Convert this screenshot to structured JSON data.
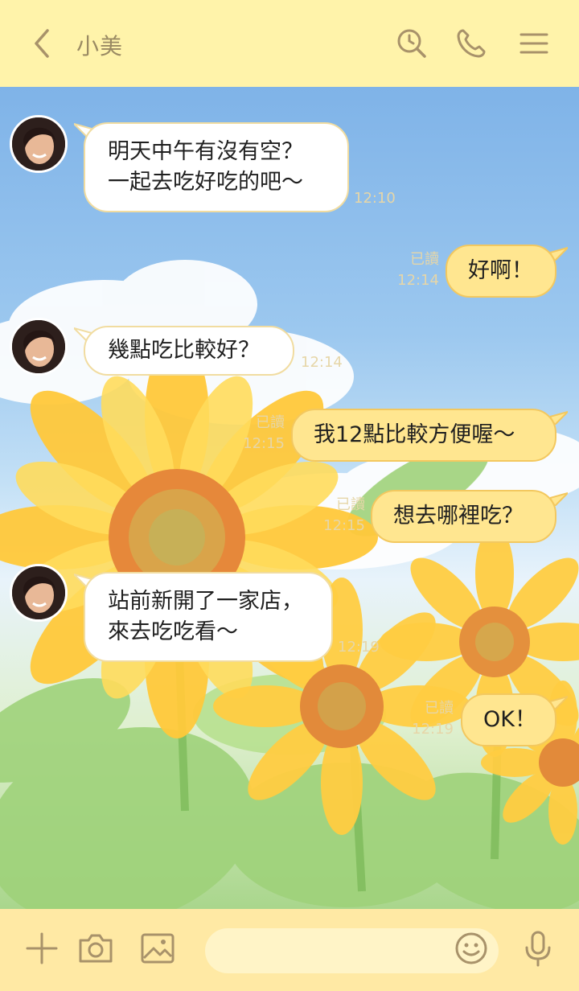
{
  "header": {
    "title": "小美",
    "icons": [
      "back-arrow-icon",
      "search-history-icon",
      "phone-icon",
      "menu-icon"
    ]
  },
  "messages": [
    {
      "side": "in",
      "text": "明天中午有沒有空？\n一起去吃好吃的吧〜",
      "time": "12:10"
    },
    {
      "side": "out",
      "text": "好啊！",
      "read": "已讀",
      "time": "12:14"
    },
    {
      "side": "in",
      "text": "幾點吃比較好？",
      "time": "12:14"
    },
    {
      "side": "out",
      "text": "我12點比較方便喔〜",
      "read": "已讀",
      "time": "12:15"
    },
    {
      "side": "out",
      "text": "想去哪裡吃？",
      "read": "已讀",
      "time": "12:15"
    },
    {
      "side": "in",
      "text": "站前新開了一家店，\n來去吃吃看〜",
      "time": "12:19"
    },
    {
      "side": "out",
      "text": "OK！",
      "read": "已讀",
      "time": "12:19"
    }
  ],
  "composer": {
    "placeholder": ""
  },
  "colors": {
    "header_bg": "#fff3aa",
    "bar_bg": "#ffe9a4",
    "outgoing_bubble": "#ffe690",
    "incoming_bubble": "#ffffff",
    "icon": "#a8926a"
  }
}
